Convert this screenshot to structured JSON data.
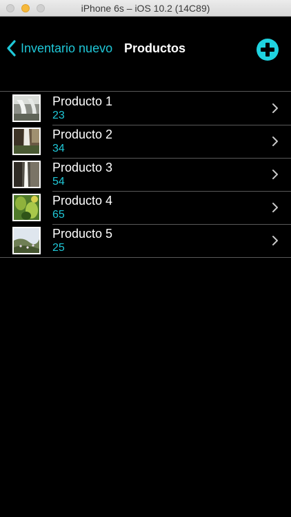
{
  "window": {
    "title": "iPhone 6s – iOS 10.2 (14C89)"
  },
  "nav": {
    "back_label": "Inventario nuevo",
    "title": "Productos",
    "add_icon": "plus-circle-icon"
  },
  "colors": {
    "accent": "#1fc8d8",
    "background": "#000000",
    "separator": "#5a5a5a",
    "title_text": "#ffffff"
  },
  "products": [
    {
      "name": "Producto 1",
      "value": "23",
      "thumbnail": "waterfall-photo"
    },
    {
      "name": "Producto 2",
      "value": "34",
      "thumbnail": "cliff-waterfall-photo"
    },
    {
      "name": "Producto 3",
      "value": "54",
      "thumbnail": "tall-waterfall-photo"
    },
    {
      "name": "Producto 4",
      "value": "65",
      "thumbnail": "green-plant-photo"
    },
    {
      "name": "Producto 5",
      "value": "25",
      "thumbnail": "hillside-flowers-photo"
    }
  ]
}
